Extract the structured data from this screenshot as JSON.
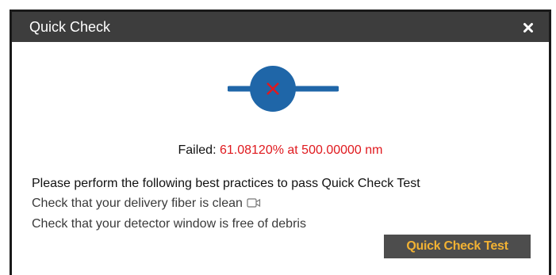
{
  "dialog": {
    "title": "Quick Check",
    "close_icon": "close-icon"
  },
  "status": {
    "icon": "fail-x-icon",
    "circle_color": "#1f66a8",
    "mark_color": "#e0191e",
    "failed_label": "Failed:",
    "failed_value": "61.08120% at 500.00000 nm"
  },
  "instructions": {
    "heading": "Please perform the following best practices to pass Quick Check Test",
    "items": [
      "Check that your delivery fiber is clean",
      "Check that your detector window is free of debris"
    ],
    "video_icon": "video-icon"
  },
  "actions": {
    "quick_check_label": "Quick Check Test",
    "button_bg": "#4d4d4d",
    "button_text_color": "#f2b233"
  }
}
